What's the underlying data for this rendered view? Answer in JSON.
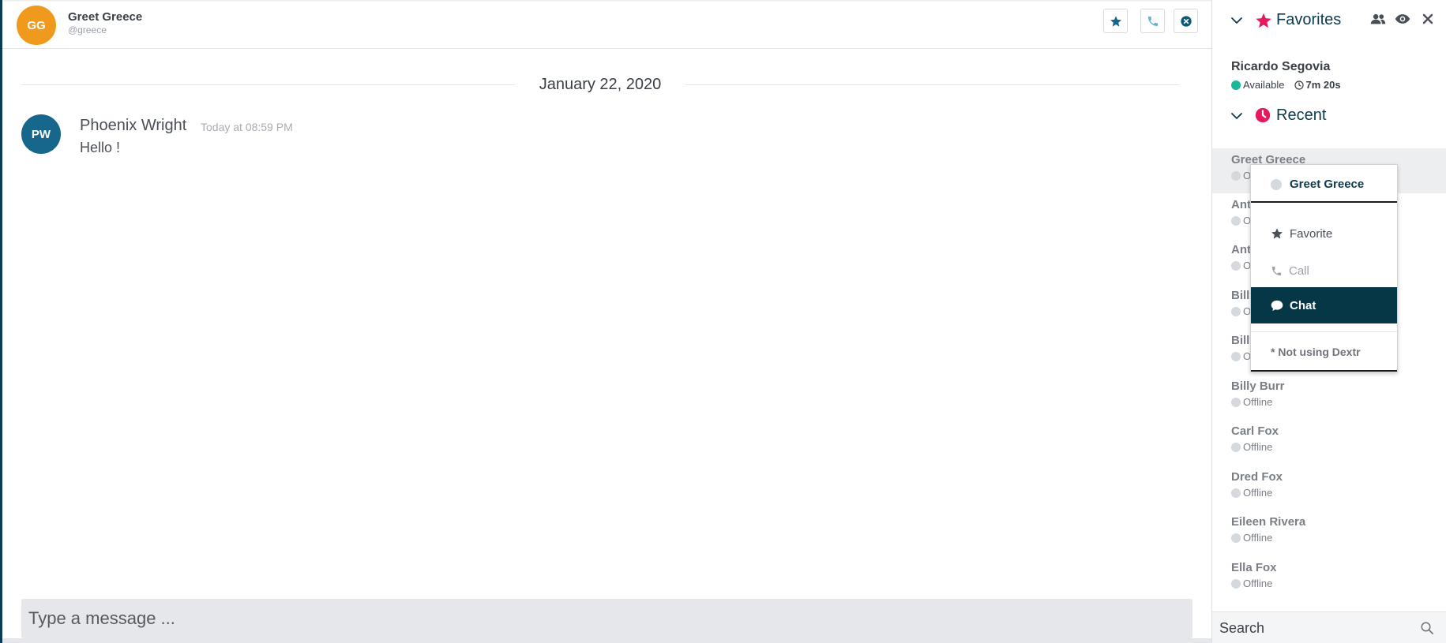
{
  "conversation": {
    "contact_initials": "GG",
    "contact_name": "Greet Greece",
    "contact_handle": "@greece",
    "actions": {
      "favorite_icon": "star-icon",
      "call_icon": "phone-icon",
      "close_icon": "close-circle-icon"
    }
  },
  "messages": {
    "date_divider": "January 22, 2020",
    "items": [
      {
        "initials": "PW",
        "author": "Phoenix Wright",
        "time": "Today at 08:59 PM",
        "text": "Hello !"
      }
    ]
  },
  "composer": {
    "placeholder": "Type a message ..."
  },
  "favorites": {
    "title": "Favorites",
    "tool_icons": [
      "contacts-icon",
      "eye-icon",
      "close-icon"
    ],
    "people": [
      {
        "name": "Ricardo Segovia",
        "status": "Available",
        "duration": "7m 20s"
      }
    ]
  },
  "recent": {
    "title": "Recent",
    "items": [
      {
        "name": "Greet Greece",
        "status": "Offline"
      },
      {
        "name": "Anthony",
        "status": "Offline"
      },
      {
        "name": "Anthony",
        "status": "Offline"
      },
      {
        "name": "Billy",
        "status": "Offline"
      },
      {
        "name": "Billy",
        "status": "Offline"
      },
      {
        "name": "Billy Burr",
        "status": "Offline"
      },
      {
        "name": "Carl Fox",
        "status": "Offline"
      },
      {
        "name": "Dred Fox",
        "status": "Offline"
      },
      {
        "name": "Eileen Rivera",
        "status": "Offline"
      },
      {
        "name": "Ella Fox",
        "status": "Offline"
      }
    ]
  },
  "context_menu": {
    "title": "Greet Greece",
    "items": {
      "favorite": "Favorite",
      "call": "Call",
      "chat": "Chat"
    },
    "footer": "* Not using Dextr"
  },
  "search": {
    "placeholder": "Search"
  },
  "colors": {
    "brand_dark": "#063747",
    "favorites_star": "#e5195f",
    "available": "#17b897",
    "gg_avatar": "#ef9a1c",
    "pw_avatar": "#17668b"
  }
}
